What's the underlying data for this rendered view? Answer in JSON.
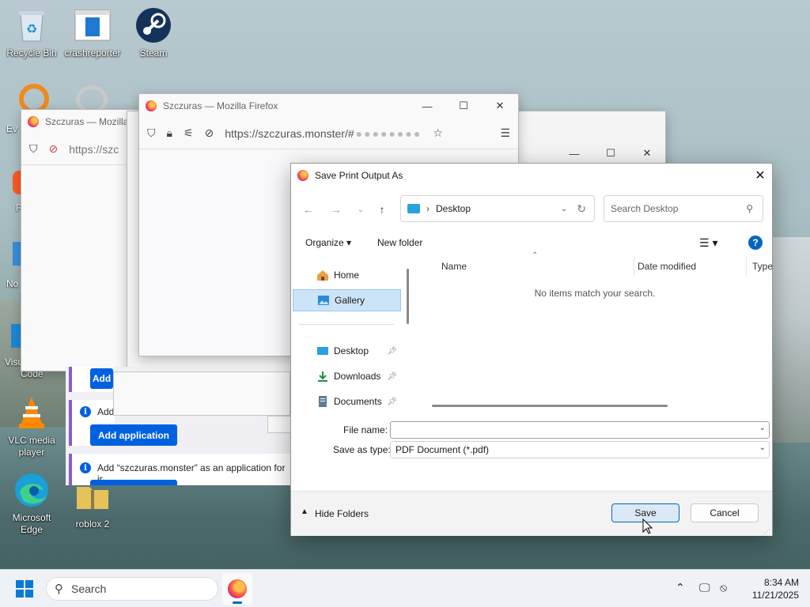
{
  "desktop": {
    "icons": [
      {
        "label": "Recycle Bin",
        "icon": "recycle-bin-icon"
      },
      {
        "label": "crashreporter",
        "icon": "crashreporter-icon"
      },
      {
        "label": "Steam",
        "icon": "steam-icon"
      },
      {
        "label": "Ev",
        "icon": "everything-icon"
      },
      {
        "label": "F",
        "icon": "firefox-shortcut-icon"
      },
      {
        "label": "No",
        "icon": "notepad-icon"
      },
      {
        "label": "Visu",
        "icon": "vscode-icon"
      },
      {
        "label": "Code",
        "icon": "vscode-label"
      },
      {
        "label": "VLC media player",
        "icon": "vlc-icon"
      },
      {
        "label": "Microsoft Edge",
        "icon": "edge-icon"
      },
      {
        "label": "roblox 2",
        "icon": "zip-folder-icon"
      }
    ]
  },
  "windows": {
    "back": {
      "title": "Szczuras — Mozilla",
      "url": "https://szc"
    },
    "front": {
      "title": "Szczuras — Mozilla Firefox",
      "url": "https://szczuras.monster/#"
    }
  },
  "notifications": {
    "add_label_1": "Add",
    "add_label_2": "Add",
    "add_button": "Add application",
    "full_text": "Add “szczuras.monster” as an application for ir"
  },
  "dialog": {
    "title": "Save Print Output As",
    "location": "Desktop",
    "search_placeholder": "Search Desktop",
    "organize": "Organize",
    "new_folder": "New folder",
    "nav": {
      "home": "Home",
      "gallery": "Gallery",
      "desktop": "Desktop",
      "downloads": "Downloads",
      "documents": "Documents"
    },
    "columns": {
      "name": "Name",
      "date": "Date modified",
      "type": "Type"
    },
    "empty_message": "No items match your search.",
    "file_name_label": "File name:",
    "file_name_value": "",
    "save_type_label": "Save as type:",
    "save_type_value": "PDF Document (*.pdf)",
    "hide_folders": "Hide Folders",
    "save": "Save",
    "cancel": "Cancel"
  },
  "taskbar": {
    "search": "Search",
    "time": "8:34 AM",
    "date": "11/21/2025"
  },
  "colors": {
    "accent": "#0067c0",
    "firefox_blue": "#0061e0"
  }
}
